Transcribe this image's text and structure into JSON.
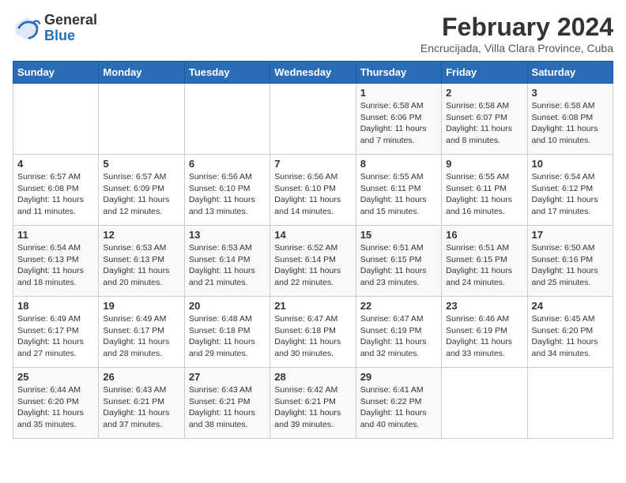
{
  "header": {
    "logo_general": "General",
    "logo_blue": "Blue",
    "title": "February 2024",
    "subtitle": "Encrucijada, Villa Clara Province, Cuba"
  },
  "days_of_week": [
    "Sunday",
    "Monday",
    "Tuesday",
    "Wednesday",
    "Thursday",
    "Friday",
    "Saturday"
  ],
  "weeks": [
    [
      {
        "day": "",
        "info": ""
      },
      {
        "day": "",
        "info": ""
      },
      {
        "day": "",
        "info": ""
      },
      {
        "day": "",
        "info": ""
      },
      {
        "day": "1",
        "info": "Sunrise: 6:58 AM\nSunset: 6:06 PM\nDaylight: 11 hours\nand 7 minutes."
      },
      {
        "day": "2",
        "info": "Sunrise: 6:58 AM\nSunset: 6:07 PM\nDaylight: 11 hours\nand 8 minutes."
      },
      {
        "day": "3",
        "info": "Sunrise: 6:58 AM\nSunset: 6:08 PM\nDaylight: 11 hours\nand 10 minutes."
      }
    ],
    [
      {
        "day": "4",
        "info": "Sunrise: 6:57 AM\nSunset: 6:08 PM\nDaylight: 11 hours\nand 11 minutes."
      },
      {
        "day": "5",
        "info": "Sunrise: 6:57 AM\nSunset: 6:09 PM\nDaylight: 11 hours\nand 12 minutes."
      },
      {
        "day": "6",
        "info": "Sunrise: 6:56 AM\nSunset: 6:10 PM\nDaylight: 11 hours\nand 13 minutes."
      },
      {
        "day": "7",
        "info": "Sunrise: 6:56 AM\nSunset: 6:10 PM\nDaylight: 11 hours\nand 14 minutes."
      },
      {
        "day": "8",
        "info": "Sunrise: 6:55 AM\nSunset: 6:11 PM\nDaylight: 11 hours\nand 15 minutes."
      },
      {
        "day": "9",
        "info": "Sunrise: 6:55 AM\nSunset: 6:11 PM\nDaylight: 11 hours\nand 16 minutes."
      },
      {
        "day": "10",
        "info": "Sunrise: 6:54 AM\nSunset: 6:12 PM\nDaylight: 11 hours\nand 17 minutes."
      }
    ],
    [
      {
        "day": "11",
        "info": "Sunrise: 6:54 AM\nSunset: 6:13 PM\nDaylight: 11 hours\nand 18 minutes."
      },
      {
        "day": "12",
        "info": "Sunrise: 6:53 AM\nSunset: 6:13 PM\nDaylight: 11 hours\nand 20 minutes."
      },
      {
        "day": "13",
        "info": "Sunrise: 6:53 AM\nSunset: 6:14 PM\nDaylight: 11 hours\nand 21 minutes."
      },
      {
        "day": "14",
        "info": "Sunrise: 6:52 AM\nSunset: 6:14 PM\nDaylight: 11 hours\nand 22 minutes."
      },
      {
        "day": "15",
        "info": "Sunrise: 6:51 AM\nSunset: 6:15 PM\nDaylight: 11 hours\nand 23 minutes."
      },
      {
        "day": "16",
        "info": "Sunrise: 6:51 AM\nSunset: 6:15 PM\nDaylight: 11 hours\nand 24 minutes."
      },
      {
        "day": "17",
        "info": "Sunrise: 6:50 AM\nSunset: 6:16 PM\nDaylight: 11 hours\nand 25 minutes."
      }
    ],
    [
      {
        "day": "18",
        "info": "Sunrise: 6:49 AM\nSunset: 6:17 PM\nDaylight: 11 hours\nand 27 minutes."
      },
      {
        "day": "19",
        "info": "Sunrise: 6:49 AM\nSunset: 6:17 PM\nDaylight: 11 hours\nand 28 minutes."
      },
      {
        "day": "20",
        "info": "Sunrise: 6:48 AM\nSunset: 6:18 PM\nDaylight: 11 hours\nand 29 minutes."
      },
      {
        "day": "21",
        "info": "Sunrise: 6:47 AM\nSunset: 6:18 PM\nDaylight: 11 hours\nand 30 minutes."
      },
      {
        "day": "22",
        "info": "Sunrise: 6:47 AM\nSunset: 6:19 PM\nDaylight: 11 hours\nand 32 minutes."
      },
      {
        "day": "23",
        "info": "Sunrise: 6:46 AM\nSunset: 6:19 PM\nDaylight: 11 hours\nand 33 minutes."
      },
      {
        "day": "24",
        "info": "Sunrise: 6:45 AM\nSunset: 6:20 PM\nDaylight: 11 hours\nand 34 minutes."
      }
    ],
    [
      {
        "day": "25",
        "info": "Sunrise: 6:44 AM\nSunset: 6:20 PM\nDaylight: 11 hours\nand 35 minutes."
      },
      {
        "day": "26",
        "info": "Sunrise: 6:43 AM\nSunset: 6:21 PM\nDaylight: 11 hours\nand 37 minutes."
      },
      {
        "day": "27",
        "info": "Sunrise: 6:43 AM\nSunset: 6:21 PM\nDaylight: 11 hours\nand 38 minutes."
      },
      {
        "day": "28",
        "info": "Sunrise: 6:42 AM\nSunset: 6:21 PM\nDaylight: 11 hours\nand 39 minutes."
      },
      {
        "day": "29",
        "info": "Sunrise: 6:41 AM\nSunset: 6:22 PM\nDaylight: 11 hours\nand 40 minutes."
      },
      {
        "day": "",
        "info": ""
      },
      {
        "day": "",
        "info": ""
      }
    ]
  ]
}
